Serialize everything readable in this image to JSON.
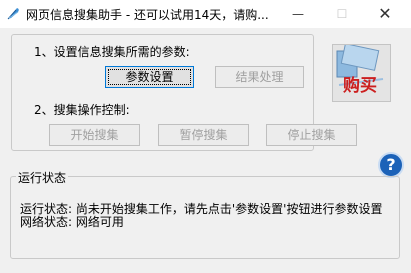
{
  "window": {
    "title": "网页信息搜集助手 - 还可以试用14天，请购...",
    "min_glyph": "—",
    "max_glyph": "☐",
    "close_glyph": "✕",
    "icon": "app-feather-icon"
  },
  "params": {
    "label": "1、设置信息搜集所需的参数:",
    "settings_button": "参数设置",
    "results_button": "结果处理"
  },
  "control": {
    "label": "2、搜集操作控制:",
    "start_button": "开始搜集",
    "pause_button": "暂停搜集",
    "stop_button": "停止搜集"
  },
  "buy": {
    "label": "购买",
    "icon": "buy-image-icon"
  },
  "help": {
    "glyph": "?",
    "icon": "help-icon"
  },
  "status": {
    "legend": "运行状态",
    "lines": [
      "运行状态: 尚未开始搜集工作，请先点击'参数设置'按钮进行参数设置",
      "网络状态: 网络可用"
    ]
  }
}
